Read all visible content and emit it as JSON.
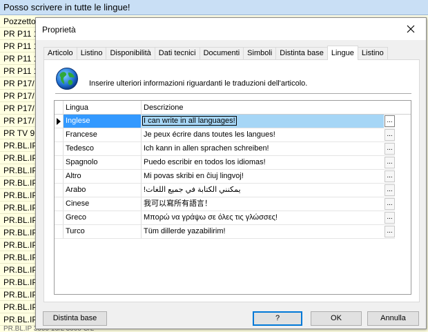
{
  "background": {
    "header": "Posso scrivere in tutte le lingue!",
    "rows": [
      "Pozzetto",
      "PR P11 1",
      "PR P11 1",
      "PR P11 1",
      "PR P11 1",
      "PR P17/",
      "PR P17/",
      "PR P17/",
      "PR P17/",
      "PR TV 9",
      "PR.BL.IP",
      "PR.BL.IP",
      "PR.BL.IP",
      "PR.BL.IP",
      "PR.BL.IP",
      "PR.BL.IP",
      "PR.BL.IP",
      "PR.BL.IP",
      "PR.BL.IP",
      "PR.BL.IP",
      "PR.BL.IP",
      "PR.BL.IP",
      "PR.BL.IP",
      "PR.BL.IP",
      "PR.BL.IP"
    ],
    "bottom_partial": "PR.BL.IP 3000 16/L 3000 C/L"
  },
  "dialog": {
    "title": "Proprietà",
    "close_label": "close",
    "tabs": [
      "Articolo",
      "Listino",
      "Disponibilità",
      "Dati tecnici",
      "Documenti",
      "Simboli",
      "Distinta base",
      "Lingue",
      "Listino"
    ],
    "active_tab_index": 7,
    "info_text": "Inserire ulteriori informazioni riguardanti le traduzioni dell'articolo.",
    "grid": {
      "columns": [
        "Lingua",
        "Descrizione"
      ],
      "selected_row": 0,
      "ellipsis": "...",
      "rows": [
        {
          "lingua": "Inglese",
          "descrizione": "I can write in all languages!"
        },
        {
          "lingua": "Francese",
          "descrizione": "Je peux écrire dans toutes les langues!"
        },
        {
          "lingua": "Tedesco",
          "descrizione": "Ich kann in allen sprachen schreiben!"
        },
        {
          "lingua": "Spagnolo",
          "descrizione": "Puedo escribir en todos los idiomas!"
        },
        {
          "lingua": "Altro",
          "descrizione": "Mi povas skribi en ĉiuj lingvoj!"
        },
        {
          "lingua": "Arabo",
          "descrizione": "!يمكنني الكتابة في جميع اللغات"
        },
        {
          "lingua": "Cinese",
          "descrizione": "我可以寫所有語言！"
        },
        {
          "lingua": "Greco",
          "descrizione": "Μπορώ να γράψω σε όλες τις γλώσσες!"
        },
        {
          "lingua": "Turco",
          "descrizione": "Tüm dillerde yazabilirim!"
        }
      ]
    },
    "buttons": {
      "distinta_base": "Distinta base",
      "help": "?",
      "ok": "OK",
      "annulla": "Annulla"
    }
  },
  "colors": {
    "selection": "#3399ff",
    "selection_light": "#a6d6f6",
    "focus_border": "#0078d7",
    "background_list": "#ffffe1"
  }
}
